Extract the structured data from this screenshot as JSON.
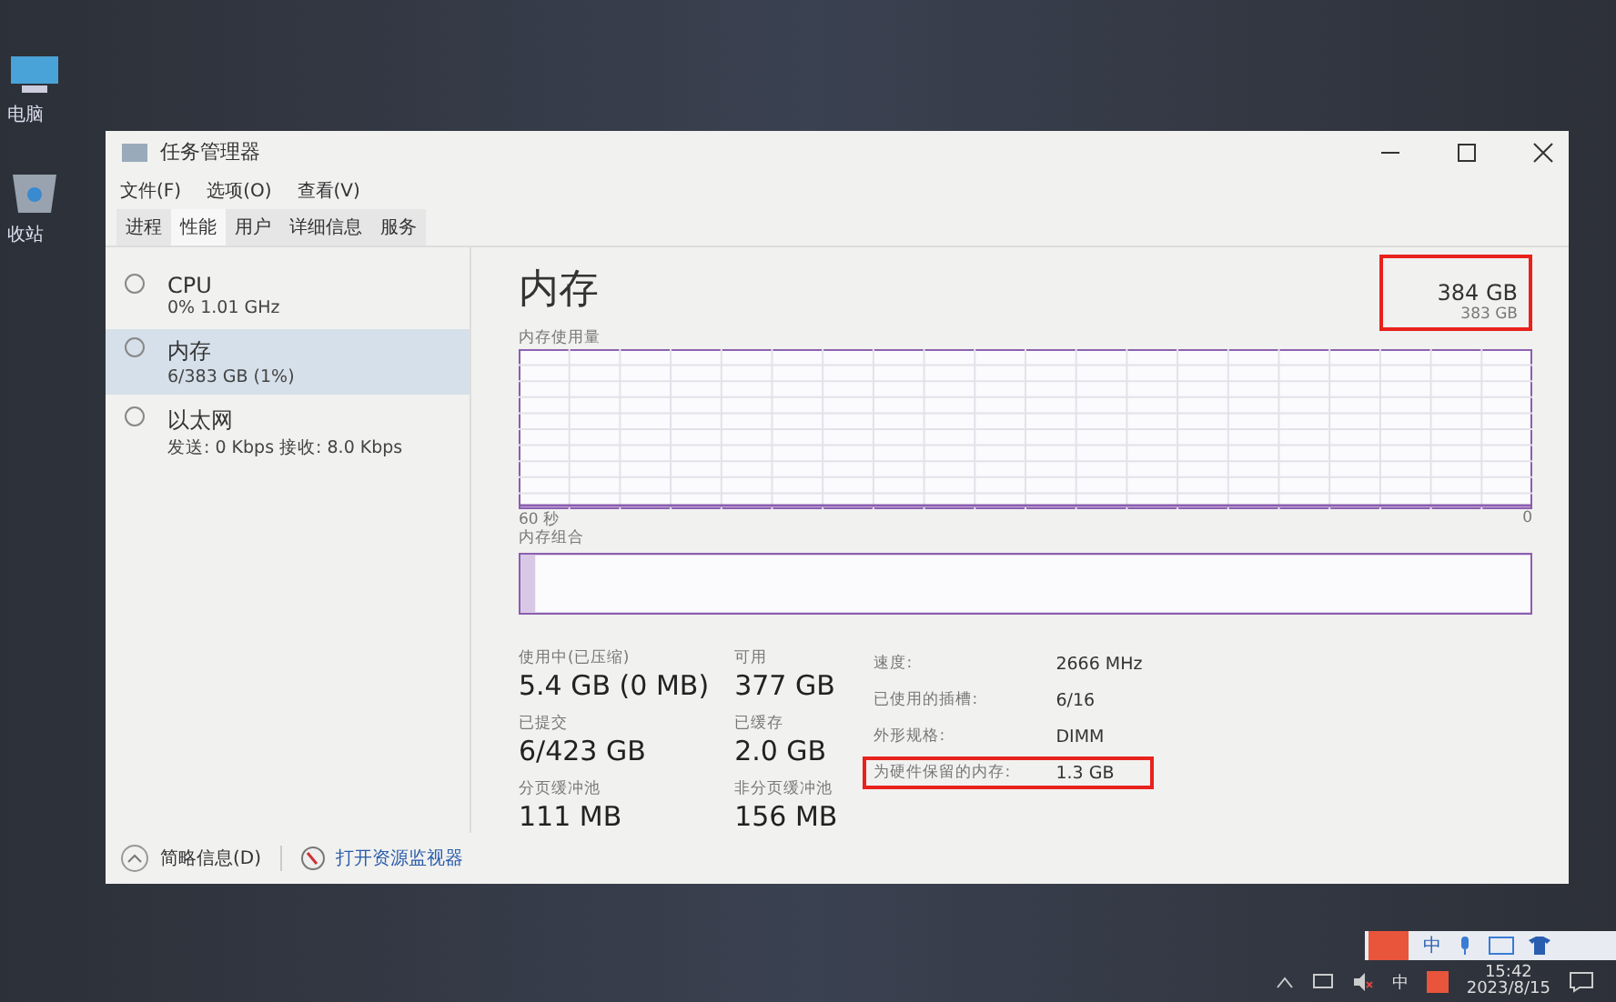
{
  "desktop_icons": [
    {
      "label": "电脑"
    },
    {
      "label": "收站"
    }
  ],
  "window": {
    "title": "任务管理器"
  },
  "menu": [
    "文件(F)",
    "选项(O)",
    "查看(V)"
  ],
  "tabs": [
    {
      "label": "进程",
      "selected": false
    },
    {
      "label": "性能",
      "selected": true
    },
    {
      "label": "用户",
      "selected": false
    },
    {
      "label": "详细信息",
      "selected": false
    },
    {
      "label": "服务",
      "selected": false
    }
  ],
  "sidebar": {
    "items": [
      {
        "name": "CPU",
        "detail": "0% 1.01 GHz",
        "selected": false
      },
      {
        "name": "内存",
        "detail": "6/383 GB (1%)",
        "selected": true
      },
      {
        "name": "以太网",
        "detail": "发送: 0 Kbps 接收: 8.0 Kbps",
        "selected": false
      }
    ]
  },
  "panel": {
    "title": "内存",
    "capacity": "384 GB",
    "capacity_highlighted": true,
    "graph_label": "内存使用量",
    "graph_max": "383 GB",
    "graph_time": "60 秒",
    "graph_min": "0",
    "composition_label": "内存组合",
    "stats": [
      [
        {
          "label": "使用中(已压缩)",
          "value": "5.4 GB (0 MB)"
        },
        {
          "label": "可用",
          "value": "377 GB"
        }
      ],
      [
        {
          "label": "已提交",
          "value": "6/423 GB"
        },
        {
          "label": "已缓存",
          "value": "2.0 GB"
        }
      ],
      [
        {
          "label": "分页缓冲池",
          "value": "111 MB"
        },
        {
          "label": "非分页缓冲池",
          "value": "156 MB"
        }
      ]
    ],
    "details": [
      {
        "label": "速度:",
        "value": "2666 MHz",
        "highlighted": false
      },
      {
        "label": "已使用的插槽:",
        "value": "6/16",
        "highlighted": false
      },
      {
        "label": "外形规格:",
        "value": "DIMM",
        "highlighted": false
      },
      {
        "label": "为硬件保留的内存:",
        "value": "1.3 GB",
        "highlighted": true
      }
    ]
  },
  "footer": {
    "summary": "简略信息(D)",
    "link": "打开资源监视器"
  },
  "ime_bar": {
    "label": "中"
  },
  "taskbar": {
    "language": "中",
    "time": "15:42",
    "date": "2023/8/15"
  }
}
